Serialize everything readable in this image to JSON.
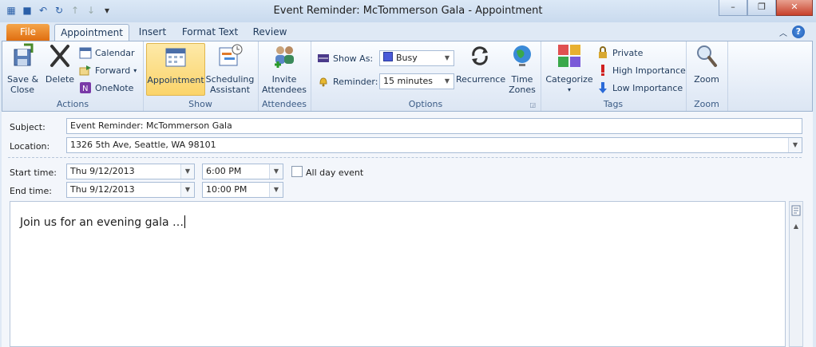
{
  "window": {
    "title": "Event Reminder: McTommerson Gala - Appointment"
  },
  "qat": {
    "icons": [
      "calendar-icon",
      "save-icon",
      "undo-icon",
      "redo-icon",
      "up-arrow-icon",
      "down-arrow-icon",
      "customize-icon"
    ]
  },
  "window_buttons": {
    "minimize": "–",
    "maximize": "❐",
    "close": "✕"
  },
  "tabs": [
    "File",
    "Appointment",
    "Insert",
    "Format Text",
    "Review"
  ],
  "help": "?",
  "ribbon": {
    "actions": {
      "save_close": "Save &\nClose",
      "delete": "Delete",
      "calendar": "Calendar",
      "forward": "Forward",
      "onenote": "OneNote",
      "label": "Actions"
    },
    "show": {
      "appointment": "Appointment",
      "scheduling": "Scheduling\nAssistant",
      "label": "Show"
    },
    "attendees": {
      "invite": "Invite\nAttendees",
      "label": "Attendees"
    },
    "options": {
      "show_as_label": "Show As:",
      "show_as_value": "Busy",
      "reminder_label": "Reminder:",
      "reminder_value": "15 minutes",
      "recurrence": "Recurrence",
      "time_zones": "Time\nZones",
      "label": "Options"
    },
    "tags": {
      "categorize": "Categorize",
      "private": "Private",
      "high": "High Importance",
      "low": "Low Importance",
      "label": "Tags"
    },
    "zoom": {
      "zoom": "Zoom",
      "label": "Zoom"
    }
  },
  "form": {
    "subject_label": "Subject:",
    "subject_value": "Event Reminder: McTommerson Gala",
    "location_label": "Location:",
    "location_value": "1326 5th Ave, Seattle, WA 98101",
    "start_label": "Start time:",
    "start_date": "Thu 9/12/2013",
    "start_time": "6:00 PM",
    "all_day": "All day event",
    "end_label": "End time:",
    "end_date": "Thu 9/12/2013",
    "end_time": "10:00 PM"
  },
  "body_text": "Join us for an evening gala …",
  "colors": {
    "file_tab": "#e06e10",
    "active_button": "#fbd46a",
    "accent": "#2a5fa8"
  }
}
